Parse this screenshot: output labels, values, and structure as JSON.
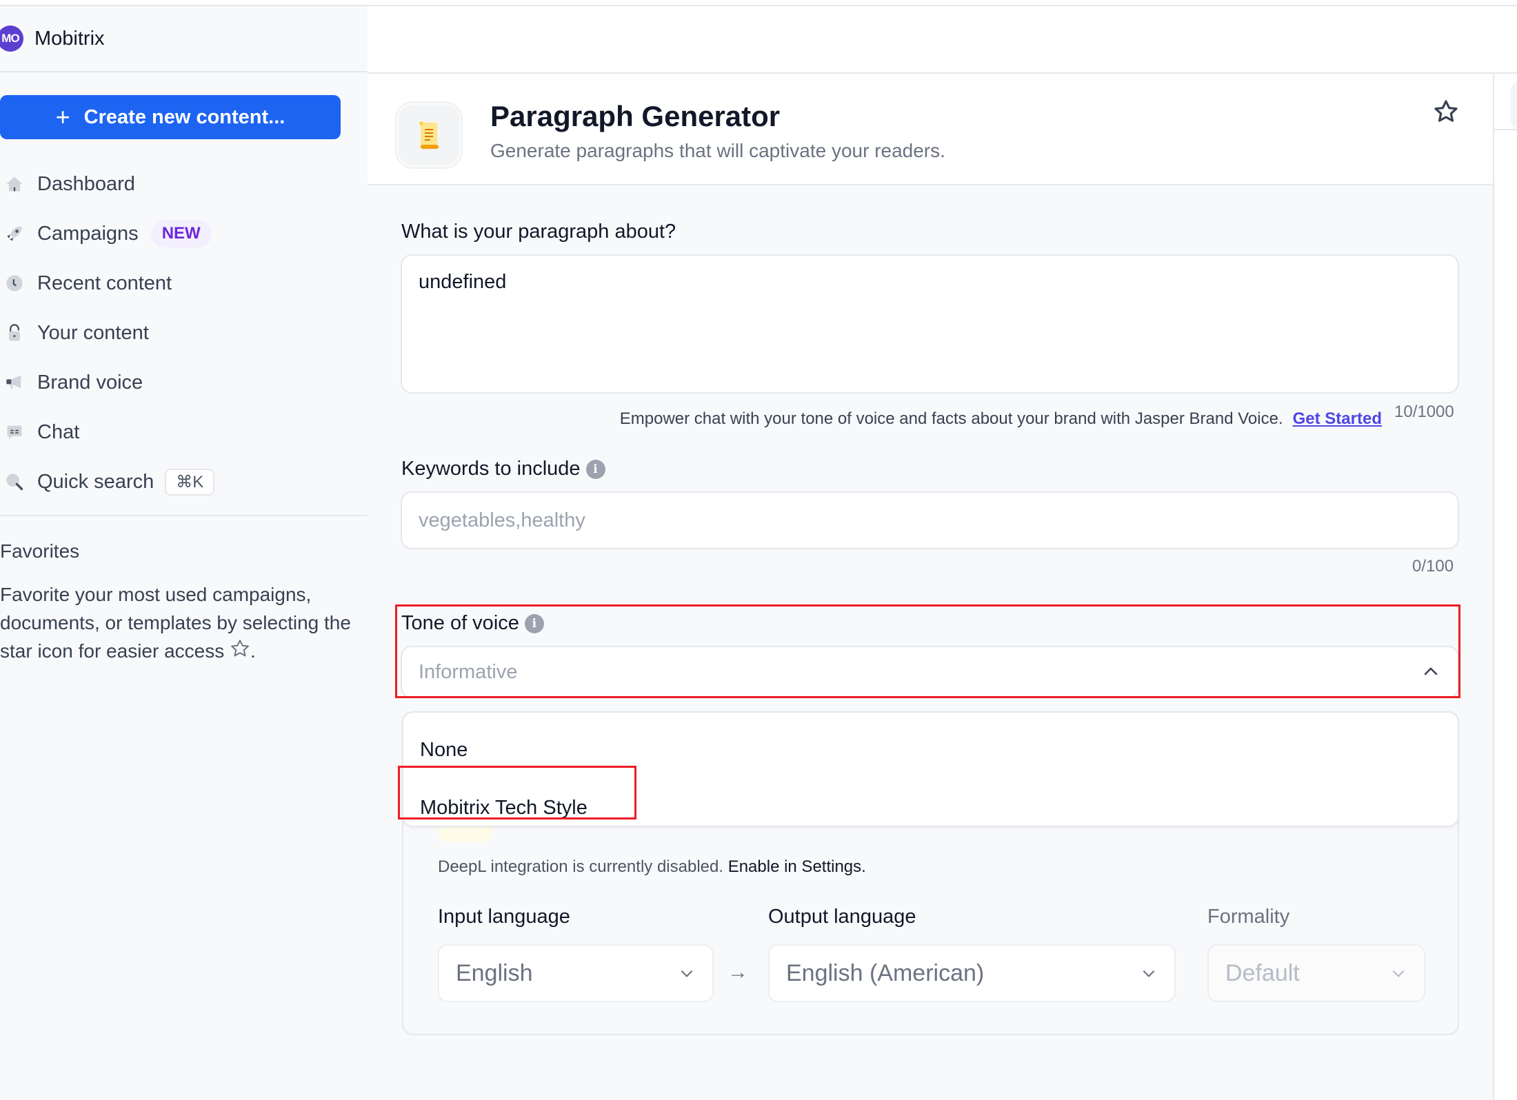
{
  "workspace": {
    "avatar_initials": "MO",
    "name": "Mobitrix"
  },
  "sidebar": {
    "create_button": {
      "icon": "plus-icon",
      "label": "Create new content..."
    },
    "items": [
      {
        "icon": "home-icon",
        "label": "Dashboard"
      },
      {
        "icon": "rocket-icon",
        "label": "Campaigns",
        "badge": "NEW"
      },
      {
        "icon": "clock-icon",
        "label": "Recent content"
      },
      {
        "icon": "lock-icon",
        "label": "Your content"
      },
      {
        "icon": "megaphone-icon",
        "label": "Brand voice"
      },
      {
        "icon": "chat-icon",
        "label": "Chat"
      },
      {
        "icon": "search-icon",
        "label": "Quick search",
        "shortcut": "⌘K"
      }
    ],
    "favorites": {
      "title": "Favorites",
      "description": "Favorite your most used campaigns, documents, or templates by selecting the star icon for easier access",
      "description_suffix": "."
    }
  },
  "header": {
    "icon": "scroll-icon",
    "title": "Paragraph Generator",
    "subtitle": "Generate paragraphs that will captivate your readers.",
    "favorite_icon": "star-icon"
  },
  "form": {
    "topic": {
      "label": "What is your paragraph about?",
      "value": "undefined",
      "helper_text": "Empower chat with your tone of voice and facts about your brand with Jasper Brand Voice.",
      "helper_link": "Get Started",
      "counter": "10/1000"
    },
    "keywords": {
      "label": "Keywords to include",
      "placeholder": "vegetables,healthy",
      "counter": "0/100"
    },
    "tone": {
      "label": "Tone of voice",
      "value": "Informative",
      "options": [
        "None",
        "Mobitrix Tech Style"
      ]
    },
    "language": {
      "deepl_note": "DeepL integration is currently disabled.",
      "deepl_link": "Enable in Settings.",
      "input_label": "Input language",
      "input_value": "English",
      "output_label": "Output language",
      "output_value": "English (American)",
      "formality_label": "Formality",
      "formality_value": "Default"
    }
  },
  "colors": {
    "primary": "#1d64f2",
    "avatar": "#5b3fd1",
    "badge_text": "#6d28d9",
    "link": "#4f46e5",
    "highlight": "#ee1c25"
  }
}
